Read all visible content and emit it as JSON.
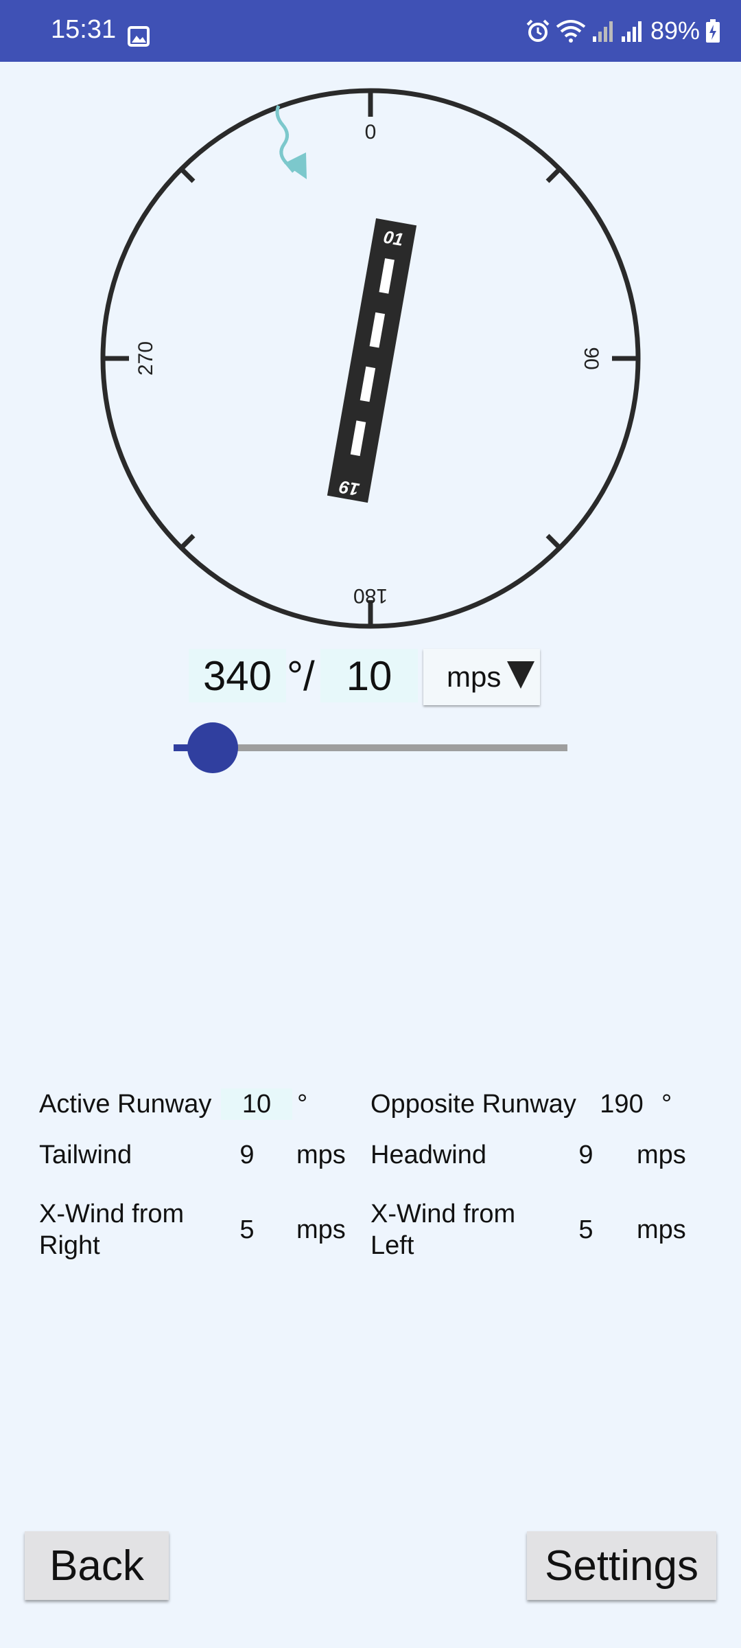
{
  "status_bar": {
    "time": "15:31",
    "battery": "89%",
    "icons": [
      "photo-icon",
      "alarm-icon",
      "wifi-icon",
      "signal-icon",
      "signal-icon",
      "battery-charging-icon"
    ]
  },
  "compass": {
    "labels": {
      "north": "0",
      "east": "90",
      "south": "180",
      "west": "270"
    },
    "runway": {
      "end_a": "01",
      "end_b": "19"
    },
    "wind_arrow_color": "#7CC8CC"
  },
  "wind_input": {
    "direction": "340",
    "degree_separator": "°/",
    "speed": "10",
    "unit": "mps"
  },
  "slider": {
    "value_fraction": 0.1
  },
  "results": {
    "active_runway_label": "Active Runway",
    "active_runway_value": "10",
    "active_runway_unit": "°",
    "opposite_runway_label": "Opposite Runway",
    "opposite_runway_value": "190",
    "opposite_runway_unit": "°",
    "tailwind_label": "Tailwind",
    "tailwind_value": "9",
    "tailwind_unit": "mps",
    "headwind_label": "Headwind",
    "headwind_value": "9",
    "headwind_unit": "mps",
    "xwind_right_label_1": "X-Wind from",
    "xwind_right_label_2": "Right",
    "xwind_right_value": "5",
    "xwind_right_unit": "mps",
    "xwind_left_label_1": "X-Wind from",
    "xwind_left_label_2": "Left",
    "xwind_left_value": "5",
    "xwind_left_unit": "mps"
  },
  "buttons": {
    "back": "Back",
    "settings": "Settings"
  },
  "colors": {
    "status_bar": "#3F51B5",
    "accent": "#303F9F",
    "background": "#EEF5FD"
  }
}
